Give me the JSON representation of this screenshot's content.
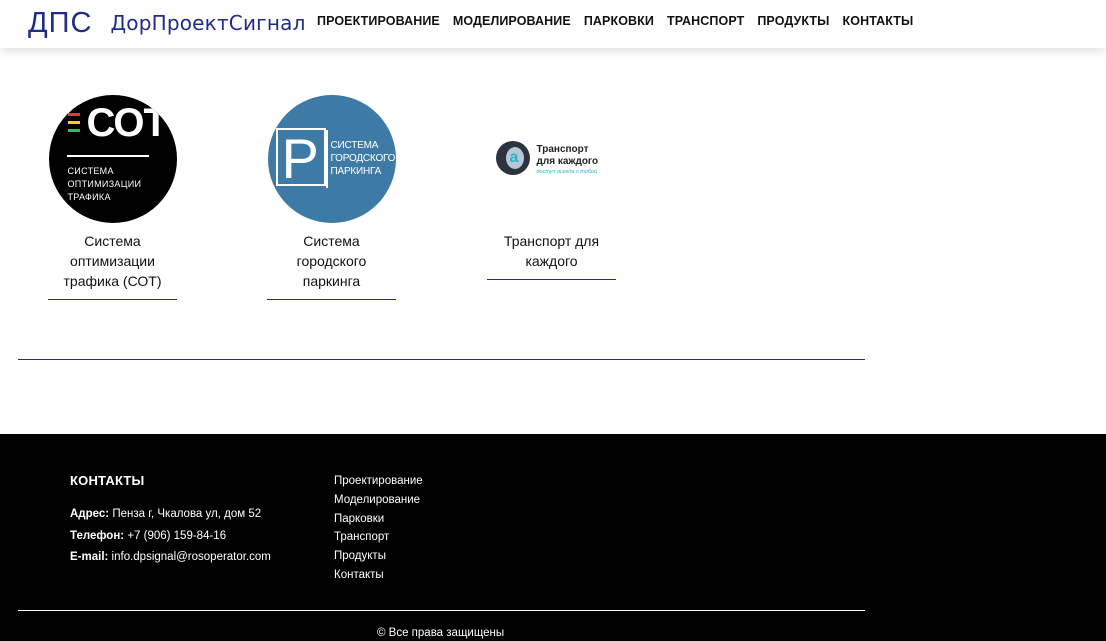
{
  "header": {
    "logo_mark": "ДПС",
    "logo_text": "ДорПроектСигнал",
    "nav": [
      "ПРОЕКТИРОВАНИЕ",
      "МОДЕЛИРОВАНИЕ",
      "ПАРКОВКИ",
      "ТРАНСПОРТ",
      "ПРОДУКТЫ",
      "КОНТАКТЫ"
    ]
  },
  "products": [
    {
      "title": "Система оптимизации трафика (СОТ)",
      "logo_big": "СОТ",
      "logo_lines": [
        "СИСТЕМА",
        "ОПТИМИЗАЦИИ",
        "ТРАФИКА"
      ]
    },
    {
      "title": "Система городского паркинга",
      "logo_letter": "P",
      "logo_lines": [
        "СИСТЕМА",
        "ГОРОДСКОГО",
        "ПАРКИНГА"
      ]
    },
    {
      "title": "Транспорт для каждого",
      "logo_lines": [
        "Транспорт",
        "для каждого"
      ],
      "logo_slogan": "доступ всегда с тобой"
    }
  ],
  "footer": {
    "contacts_title": "КОНТАКТЫ",
    "address_label": "Адрес:",
    "address_value": "Пенза г, Чкалова ул, дом 52",
    "phone_label": "Телефон:",
    "phone_value": "+7 (906) 159-84-16",
    "email_label": "E-mail:",
    "email_value": "info.dpsignal@rosoperator.com",
    "links": [
      "Проектирование",
      "Моделирование",
      "Парковки",
      "Транспорт",
      "Продукты",
      "Контакты"
    ],
    "copyright": "© Все права защищены"
  },
  "colors": {
    "brand": "#1f2d86",
    "parking_bg": "#3d7aa5",
    "footer_bg": "#000000",
    "accent_teal": "#2bb3c9"
  }
}
